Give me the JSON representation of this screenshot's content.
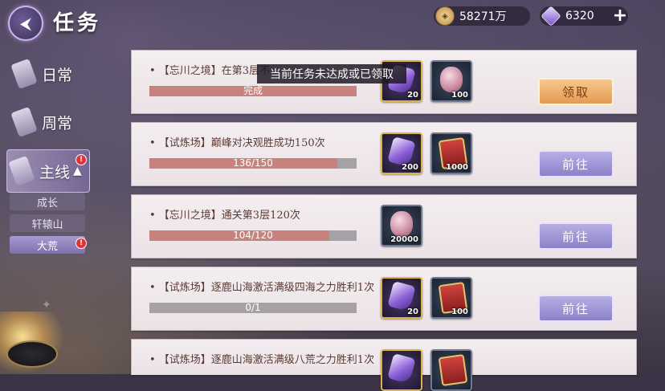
{
  "header": {
    "title": "任务",
    "coins": "58271万",
    "gems": "6320"
  },
  "sidebar": {
    "tabs": [
      {
        "label": "日常"
      },
      {
        "label": "周常"
      },
      {
        "label": "主线"
      }
    ],
    "sub_tabs": [
      {
        "label": "成长"
      },
      {
        "label": "轩辕山"
      },
      {
        "label": "大荒"
      }
    ]
  },
  "toast": "当前任务未达成或已领取",
  "quests": [
    {
      "desc": "• 【忘川之境】在第3层不",
      "progress_text": "完成",
      "progress": 1.0,
      "rewards": [
        "20",
        "100"
      ],
      "button": "领取"
    },
    {
      "desc": "• 【试炼场】巅峰对决观胜成功150次",
      "progress_text": "136/150",
      "progress": 0.907,
      "rewards": [
        "200",
        "1000"
      ],
      "button": "前往"
    },
    {
      "desc": "• 【忘川之境】通关第3层120次",
      "progress_text": "104/120",
      "progress": 0.867,
      "rewards": [
        "20000"
      ],
      "button": "前往"
    },
    {
      "desc": "• 【试炼场】逐鹿山海激活满级四海之力胜利1次",
      "progress_text": "0/1",
      "progress": 0.0,
      "rewards": [
        "20",
        "100"
      ],
      "button": "前往"
    },
    {
      "desc": "• 【试炼场】逐鹿山海激活满级八荒之力胜利1次",
      "progress_text": "",
      "progress": 0.0,
      "rewards": [
        "",
        ""
      ],
      "button": ""
    }
  ],
  "colors": {
    "progress_fill": "#c8827d",
    "progress_track": "#a6a1a7",
    "claim_button": "#e59a52",
    "go_button": "#8c81c9",
    "badge_red": "#e0343a"
  }
}
